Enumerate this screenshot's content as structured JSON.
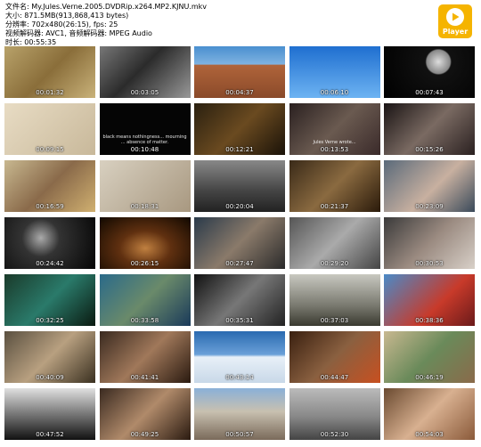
{
  "info": {
    "line1": "文件名: My.Jules.Verne.2005.DVDRip.x264.MP2.KJNU.mkv",
    "line2": "大小: 871.5MB(913,868,413 bytes)",
    "line3": "分辨率: 702x480(26:15), fps: 25",
    "line4": "视频解码器: AVC1, 音频解码器: MPEG Audio",
    "line5": "时长: 00:55:35"
  },
  "player": {
    "label": "Player",
    "icon": "play-icon",
    "color": "#f5b400"
  },
  "thumbnails": [
    {
      "time": "00:01:32",
      "bg": "linear-gradient(135deg,#b8a26a,#8a6e3a 50%,#c9b27a)"
    },
    {
      "time": "00:03:05",
      "bg": "linear-gradient(135deg,#777,#2b2b2b 45%,#999)"
    },
    {
      "time": "00:04:37",
      "bg": "linear-gradient(180deg,#4a8fd0 0%,#7fb3e0 35%,#b0643a 36%,#8a4a2a)"
    },
    {
      "time": "00:06:10",
      "bg": "linear-gradient(180deg,#1f6fd0,#6db3f2)"
    },
    {
      "time": "00:07:43",
      "bg": "radial-gradient(circle at 60% 30%,#ddd 0,#888 18%,#111 20%,#000)"
    },
    {
      "time": "00:09:15",
      "bg": "linear-gradient(135deg,#e8dcc4,#c8b89a)"
    },
    {
      "time": "00:10:48",
      "bg": "#050505",
      "caption": "black means nothingness... mourning ... absence of matter."
    },
    {
      "time": "00:12:21",
      "bg": "linear-gradient(135deg,#2a2010,#6a4a20 50%,#1a1208)"
    },
    {
      "time": "00:13:53",
      "bg": "linear-gradient(135deg,#2a2020,#6a5a50 50%,#3a2a2a)",
      "caption": "Jules Verne wrote..."
    },
    {
      "time": "00:15:26",
      "bg": "linear-gradient(135deg,#1a1414,#7a6a62 50%,#2a2020)"
    },
    {
      "time": "00:16:59",
      "bg": "linear-gradient(135deg,#c8b890,#8a6a4a 50%,#d0b070)"
    },
    {
      "time": "00:18:31",
      "bg": "linear-gradient(135deg,#d8d0c0,#a89880)"
    },
    {
      "time": "00:20:04",
      "bg": "linear-gradient(180deg,#888,#444 60%,#222)"
    },
    {
      "time": "00:21:37",
      "bg": "linear-gradient(135deg,#3a2a18,#8a6a40 50%,#2a1a0a)"
    },
    {
      "time": "00:23:09",
      "bg": "linear-gradient(135deg,#5a6a7a,#c8b0a0 55%,#3a4a5a)"
    },
    {
      "time": "00:24:42",
      "bg": "radial-gradient(circle at 40% 40%,#aaa 0,#333 30%,#050505)"
    },
    {
      "time": "00:26:15",
      "bg": "radial-gradient(ellipse at 50% 60%,#c08040 0,#603010 40%,#100800)"
    },
    {
      "time": "00:27:47",
      "bg": "linear-gradient(135deg,#2a3a4a,#8a7a6a 50%,#2a2a2a)"
    },
    {
      "time": "00:29:20",
      "bg": "linear-gradient(135deg,#555,#aaa 50%,#444)"
    },
    {
      "time": "00:30:53",
      "bg": "linear-gradient(135deg,#3a3a3a,#9a8a80 50%,#d8d0c8)"
    },
    {
      "time": "00:32:25",
      "bg": "linear-gradient(135deg,#1a3a2a,#2a7a6a 50%,#0a1a10)"
    },
    {
      "time": "00:33:58",
      "bg": "linear-gradient(135deg,#2a6a8a,#6a8a6a 50%,#1a3a5a)"
    },
    {
      "time": "00:35:31",
      "bg": "linear-gradient(135deg,#111,#777 50%,#222)"
    },
    {
      "time": "00:37:03",
      "bg": "linear-gradient(180deg,#c8c8c0,#7a7a70 60%,#3a3a30)"
    },
    {
      "time": "00:38:36",
      "bg": "linear-gradient(135deg,#4a8ac8,#c83a2a 60%,#6a1a1a)"
    },
    {
      "time": "00:40:09",
      "bg": "linear-gradient(135deg,#5a5040,#b8a080 50%,#3a3020)"
    },
    {
      "time": "00:41:41",
      "bg": "linear-gradient(135deg,#3a2a20,#a0785a 50%,#2a1a10)"
    },
    {
      "time": "00:43:14",
      "bg": "linear-gradient(180deg,#2a6ab0,#6aa0d8 45%,#e8f0f8 50%,#c8d8e8)"
    },
    {
      "time": "00:44:47",
      "bg": "linear-gradient(135deg,#3a2010,#8a6040 50%,#c85020)"
    },
    {
      "time": "00:46:19",
      "bg": "linear-gradient(135deg,#c8b890,#6a8a5a 50%,#8a6a4a)"
    },
    {
      "time": "00:47:52",
      "bg": "linear-gradient(180deg,#e0e0e0,#777 50%,#111)"
    },
    {
      "time": "00:49:25",
      "bg": "linear-gradient(135deg,#3a2a20,#b08a6a 50%,#2a1a10)"
    },
    {
      "time": "00:50:57",
      "bg": "linear-gradient(180deg,#8ab0d8,#c8c0b0 45%,#7a6a5a)"
    },
    {
      "time": "00:52:30",
      "bg": "linear-gradient(180deg,#bbb,#888 55%,#444)"
    },
    {
      "time": "00:54:03",
      "bg": "linear-gradient(135deg,#6a4a30,#d8b090 50%,#8a5a3a)"
    }
  ]
}
